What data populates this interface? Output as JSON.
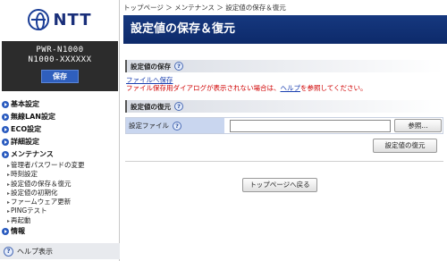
{
  "logo": {
    "text": "NTT"
  },
  "device": {
    "model": "PWR-N1000",
    "serial": "N1000-XXXXXX",
    "save_label": "保存"
  },
  "nav": {
    "basic": "基本設定",
    "wlan": "無線LAN設定",
    "eco": "ECO設定",
    "detail": "詳細設定",
    "maintenance": "メンテナンス",
    "maintenance_items": [
      "管理者パスワードの変更",
      "時刻設定",
      "設定値の保存＆復元",
      "設定値の初期化",
      "ファームウェア更新",
      "PINGテスト",
      "再起動"
    ],
    "info": "情報"
  },
  "help": {
    "label": "ヘルプ表示",
    "icon": "question-icon"
  },
  "breadcrumb": "トップページ ＞ メンテナンス ＞ 設定値の保存＆復元",
  "page_title": "設定値の保存＆復元",
  "save_section": {
    "title": "設定値の保存",
    "link": "ファイルへ保存",
    "warning_prefix": "ファイル保存用ダイアログが表示されない場合は、",
    "warning_link": "ヘルプ",
    "warning_suffix": "を参照してください。"
  },
  "restore_section": {
    "title": "設定値の復元",
    "file_label": "設定ファイル",
    "file_value": "",
    "browse_label": "参照...",
    "restore_label": "設定値の復元"
  },
  "top_button_label": "トップページへ戻る",
  "colors": {
    "title_bar": "#0d2a6a",
    "accent": "#2f5fbd",
    "warning": "#d00000",
    "link": "#1a3fb0"
  }
}
